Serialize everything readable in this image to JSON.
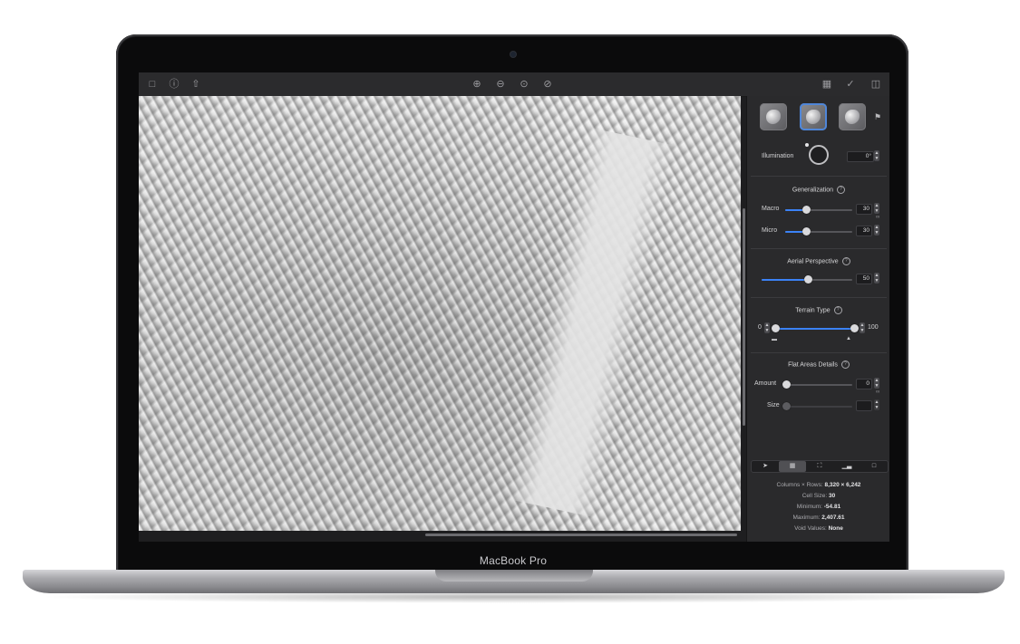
{
  "device": {
    "label": "MacBook Pro"
  },
  "toolbar": {
    "left_icons": [
      "document-icon",
      "info-icon",
      "share-icon"
    ],
    "center_icons": [
      "zoom-in-icon",
      "zoom-out-icon",
      "zoom-fit-icon",
      "zoom-actual-icon"
    ],
    "right_icons": [
      "map-icon",
      "check-icon",
      "sidebar-icon"
    ]
  },
  "panel": {
    "presets": [
      "preset-1",
      "preset-2",
      "preset-3"
    ],
    "selected_preset": 1,
    "illumination": {
      "label": "Illumination",
      "value": "0°"
    },
    "generalization": {
      "title": "Generalization",
      "macro": {
        "label": "Macro",
        "value": "30",
        "level": 0.3
      },
      "micro": {
        "label": "Micro",
        "value": "30",
        "level": 0.3
      }
    },
    "aerial_perspective": {
      "title": "Aerial Perspective",
      "value": "50",
      "level": 0.5
    },
    "terrain_type": {
      "title": "Terrain Type",
      "min": "0",
      "max": "100",
      "low": 0.0,
      "high": 1.0
    },
    "flat_areas": {
      "title": "Flat Areas Details",
      "amount": {
        "label": "Amount",
        "value": "0",
        "level": 0.0
      },
      "size": {
        "label": "Size",
        "value": "",
        "level": 0.0
      }
    },
    "tools": [
      "pointer-icon",
      "grid-icon",
      "crop-icon",
      "histogram-icon",
      "file-icon"
    ],
    "active_tool": 1,
    "stats": {
      "columns_rows_label": "Columns × Rows:",
      "columns_rows_value": "8,320 × 6,242",
      "cell_size_label": "Cell Size:",
      "cell_size_value": "30",
      "minimum_label": "Minimum:",
      "minimum_value": "-54.81",
      "maximum_label": "Maximum:",
      "maximum_value": "2,407.61",
      "void_label": "Void Values:",
      "void_value": "None"
    }
  },
  "colors": {
    "accent": "#3b82f6",
    "panel_bg": "#2a2a2c",
    "toolbar_bg": "#2b2b2d"
  }
}
